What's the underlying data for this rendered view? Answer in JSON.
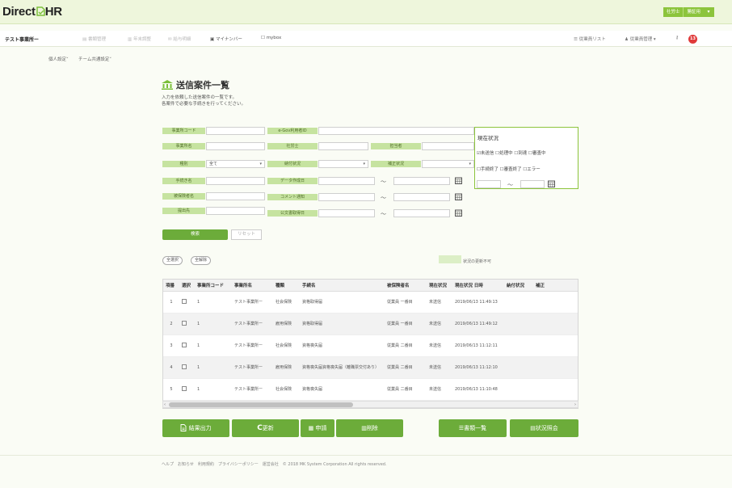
{
  "app": {
    "logo": "Direct",
    "logo_suffix": "HR"
  },
  "user": {
    "role_label": "社労士",
    "name_label": "勝証用",
    "caret": "▾"
  },
  "nav": {
    "company": "テスト事業所ー",
    "items": [
      "書類管理",
      "年末調整",
      "給与明細",
      "マイナンバー"
    ],
    "mybox": "mybox",
    "employee_list": "従業員リスト",
    "employee_mgmt": "従業員管理 ▾",
    "notif_count": "13"
  },
  "subnav": {
    "personal": "個人設定",
    "team": "チーム共通設定"
  },
  "main": {
    "title": "送信案件一覧",
    "desc1": "入力を依頼した送信案件の一覧です。",
    "desc2": "各案件で必要な手続きを行ってください。"
  },
  "form": {
    "office_code": "事業所コード",
    "egov": "e-Gov利用者ID",
    "office_name": "事業所名",
    "sharoushi": "社労士",
    "assignee": "担当者",
    "kind": "種別",
    "kind_value": "全て",
    "payment": "納付状況",
    "correction": "補正状況",
    "procedure": "手続き名",
    "data_date": "データ作成日",
    "insured": "被保険者名",
    "comment_date": "コメント通知",
    "submit_to": "提出先",
    "doc_date": "公文書取得日",
    "tilde": "～"
  },
  "status_box": {
    "title": "現在状況",
    "line1": "☑未送信 ☐処理中 ☐到達 ☐審査中",
    "line2": "☐手続終了 ☐審査終了 ☐エラー",
    "tilde": "～"
  },
  "buttons": {
    "search": "検索",
    "reset": "リセット",
    "select_all": "全選択",
    "deselect_all": "全解除",
    "legend": "状況の更新不可"
  },
  "table": {
    "headers": [
      "項番",
      "選択",
      "事業所コード",
      "事業所名",
      "種類",
      "手続名",
      "被保険者名",
      "現在状況",
      "現在状況 日時",
      "納付状況",
      "補正"
    ],
    "rows": [
      [
        "1",
        "1",
        "テスト事業所ー",
        "社会保険",
        "資格取得届",
        "従業員 一番目",
        "未送信",
        "2019/06/13 11:49:13"
      ],
      [
        "2",
        "1",
        "テスト事業所ー",
        "雇用保険",
        "資格取得届",
        "従業員 一番目",
        "未送信",
        "2019/06/13 11:49:12"
      ],
      [
        "3",
        "1",
        "テスト事業所ー",
        "社会保険",
        "資格喪失届",
        "従業員 二番目",
        "未送信",
        "2019/06/13 11:12:11"
      ],
      [
        "4",
        "1",
        "テスト事業所ー",
        "雇用保険",
        "資格喪失届資格喪失届（離職票交付あり）",
        "従業員 二番目",
        "未送信",
        "2019/06/13 11:12:10"
      ],
      [
        "5",
        "1",
        "テスト事業所ー",
        "社会保険",
        "資格喪失届",
        "従業員 二番目",
        "未送信",
        "2019/06/13 11:10:48"
      ]
    ]
  },
  "actions": {
    "export": "結果出力",
    "refresh": "更新",
    "apply": "申請",
    "delete": "削除",
    "doc_list": "書類一覧",
    "status_inquiry": "状況照会"
  },
  "footer": "ヘルプ　お知らせ　利用規約　プライバシーポリシー　運営会社　© 2018 MK System Corporation All rights reserved.",
  "colors": {
    "brand": "#6cac3a",
    "label_bg": "#c6e3a0",
    "badge": "#e03a3a"
  }
}
